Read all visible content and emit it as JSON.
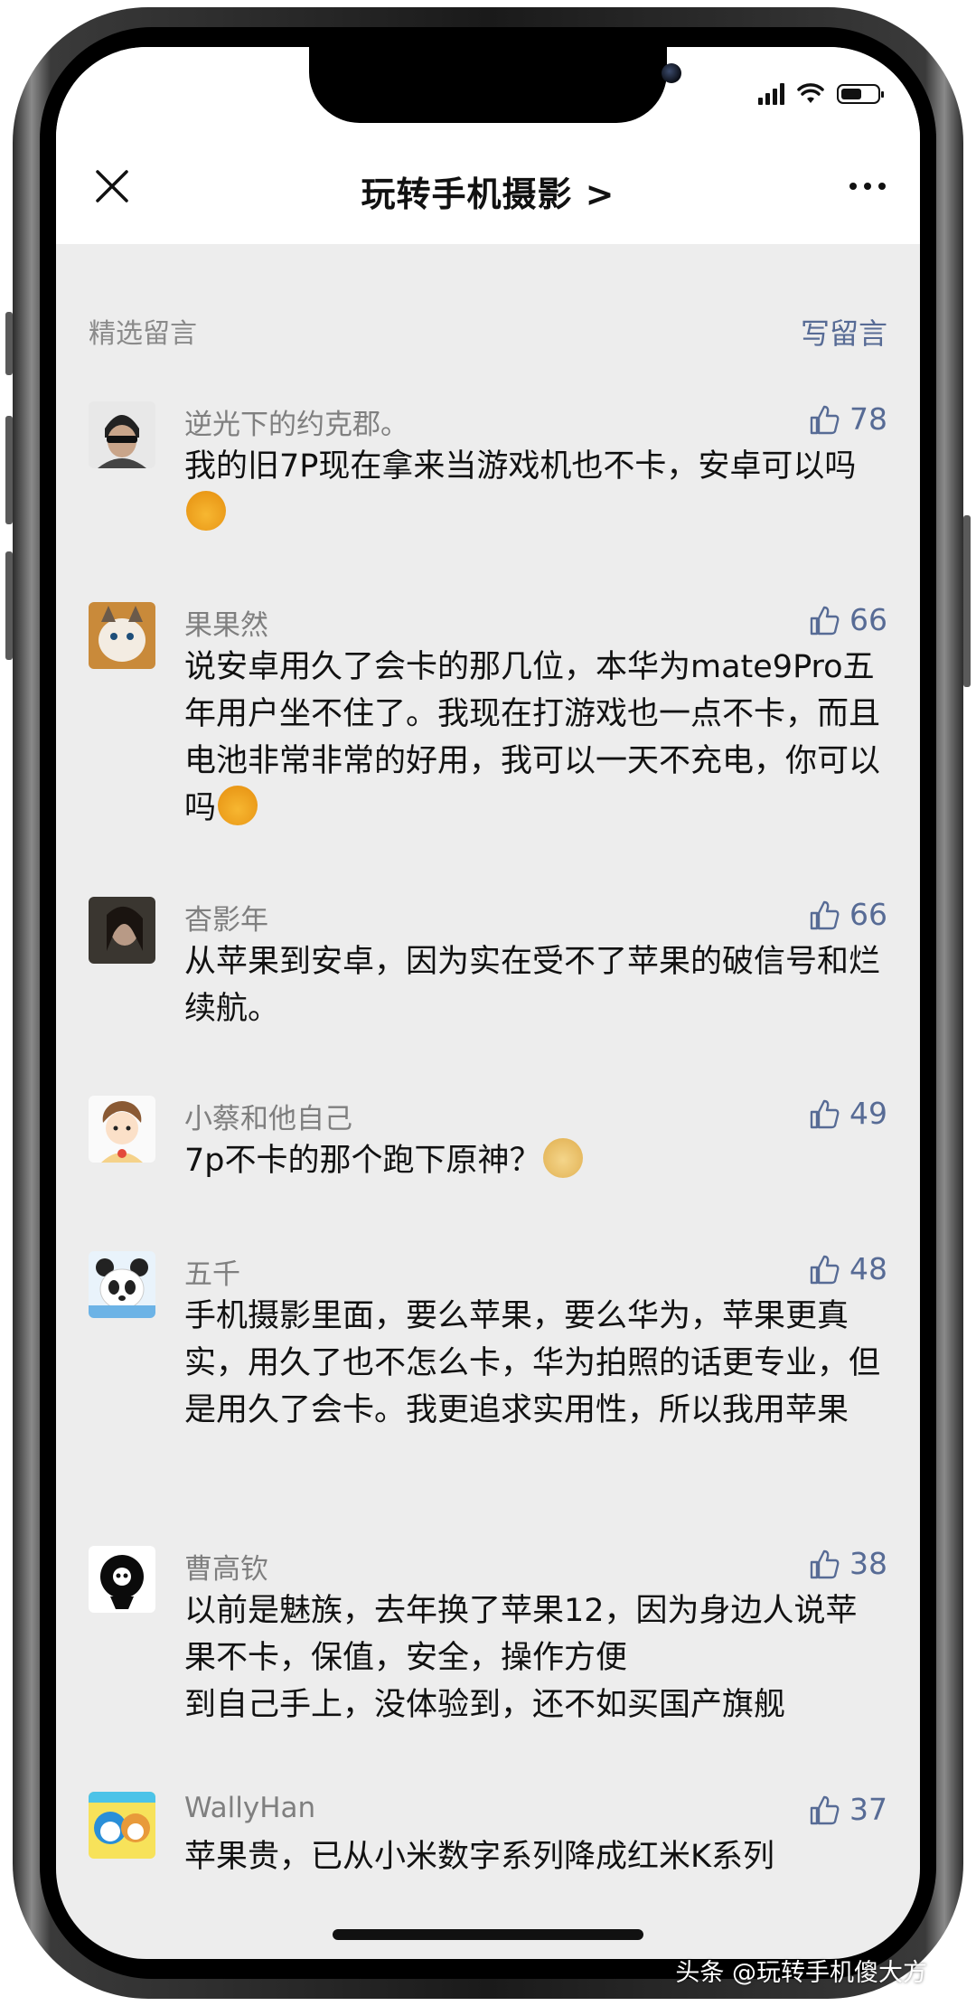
{
  "header": {
    "title": "玩转手机摄影 >"
  },
  "section": {
    "title": "精选留言",
    "write_label": "写留言"
  },
  "comments": [
    {
      "name": "逆光下的约克郡。",
      "likes": "78",
      "text": "我的旧7P现在拿来当游戏机也不卡，安卓可以吗",
      "emoji": "sunglasses-emoji"
    },
    {
      "name": "果果然",
      "likes": "66",
      "text": "说安卓用久了会卡的那几位，本华为mate9Pro五年用户坐不住了。我现在打游戏也一点不卡，而且电池非常非常的好用，我可以一天不充电，你可以吗",
      "emoji": "sunglasses-emoji"
    },
    {
      "name": "杳影年",
      "likes": "66",
      "text": "从苹果到安卓，因为实在受不了苹果的破信号和烂续航。"
    },
    {
      "name": "小蔡和他自己",
      "likes": "49",
      "text": "7p不卡的那个跑下原神？",
      "emoji": "doge-emoji"
    },
    {
      "name": "五千",
      "likes": "48",
      "text": "手机摄影里面，要么苹果，要么华为，苹果更真实，用久了也不怎么卡，华为拍照的话更专业，但是用久了会卡。我更追求实用性，所以我用苹果"
    },
    {
      "name": "曹高钦",
      "likes": "38",
      "text": "以前是魅族，去年换了苹果12，因为身边人说苹果不卡，保值，安全，操作方便\n到自己手上，没体验到，还不如买国产旗舰"
    },
    {
      "name": "WallyHan",
      "likes": "37",
      "text": "苹果贵，已从小米数字系列降成红米K系列"
    }
  ],
  "watermark": "头条 @玩转手机傻大方",
  "colors": {
    "link": "#576b95",
    "background": "#ededed"
  }
}
